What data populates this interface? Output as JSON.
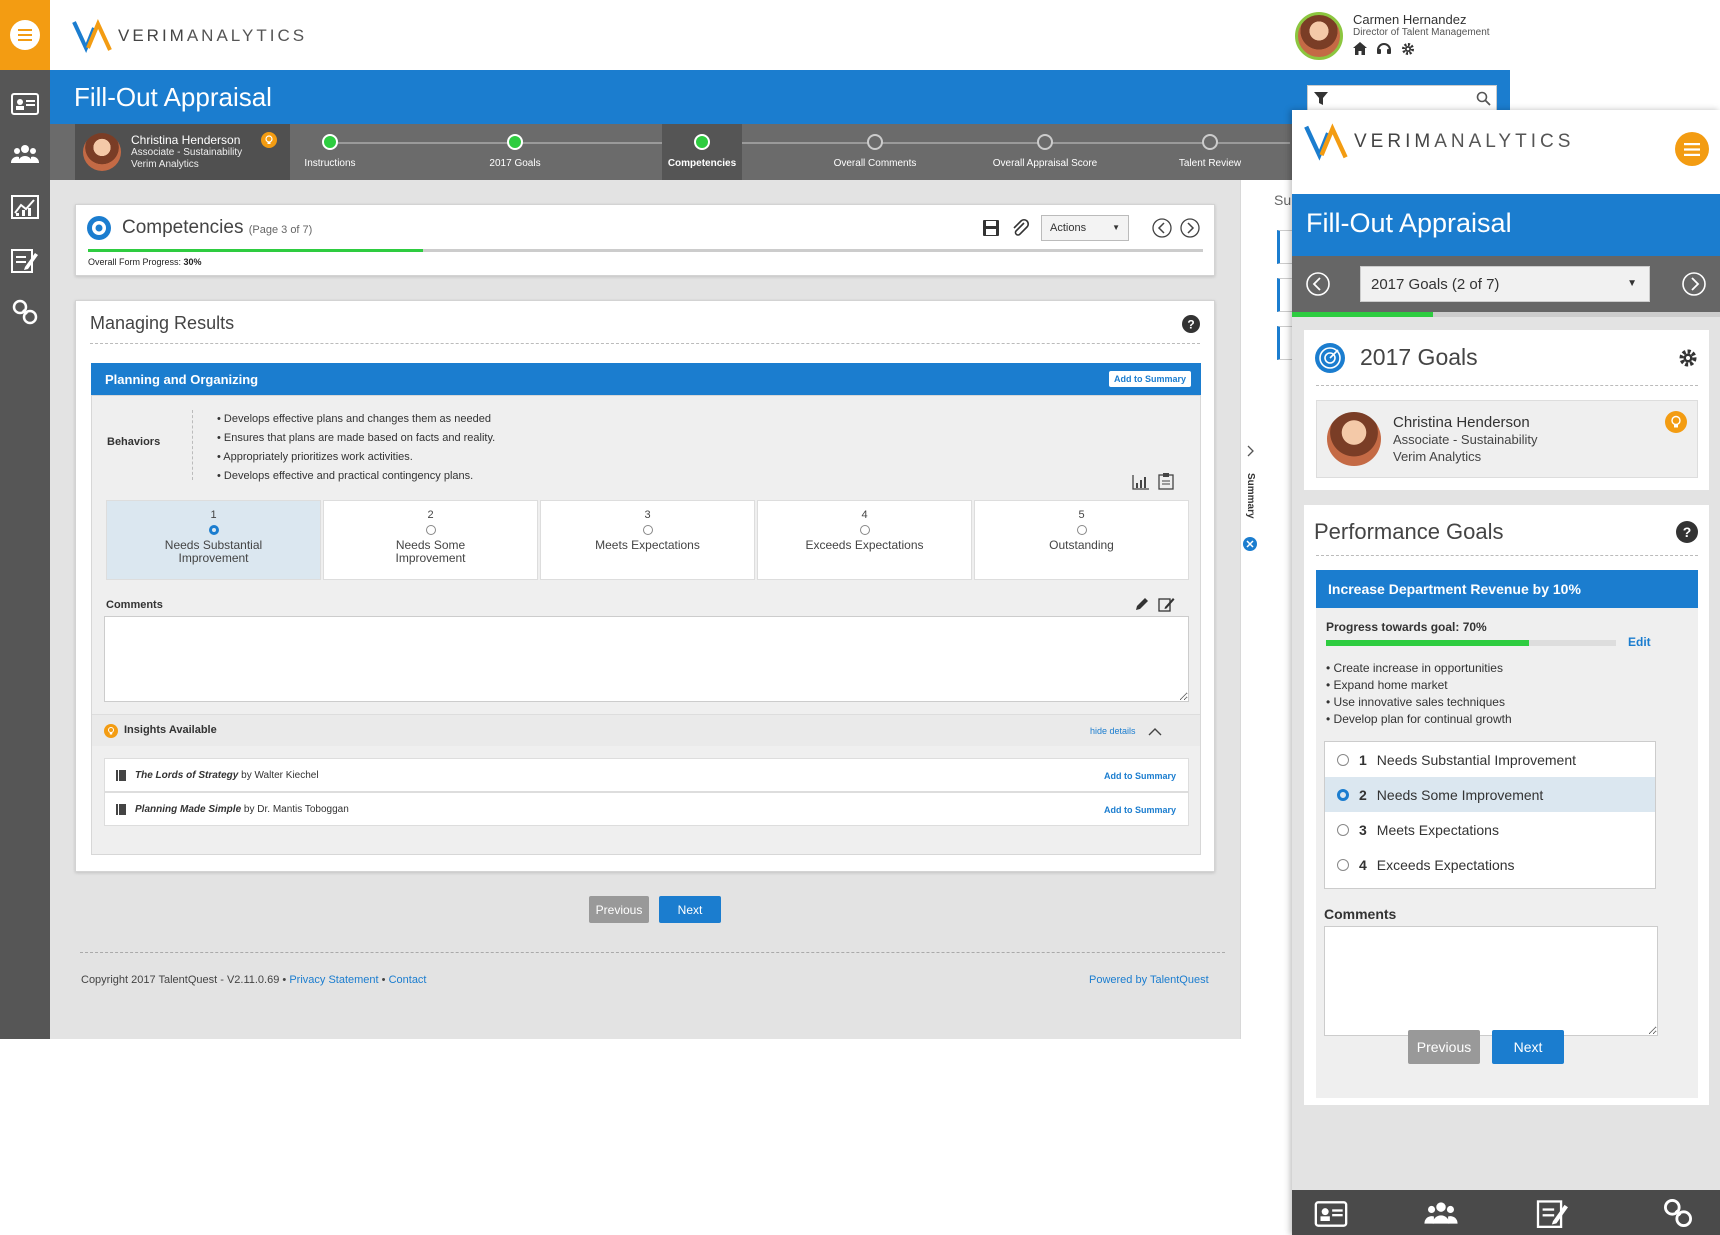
{
  "brand": {
    "logo_bold": "VERIM",
    "logo_rest": "ANALYTICS",
    "orange": "#f39c12",
    "blue": "#1b7dcf",
    "green": "#2ecc40"
  },
  "user": {
    "name": "Carmen Hernandez",
    "title": "Director of Talent Management"
  },
  "page": {
    "title": "Fill-Out Appraisal"
  },
  "employee": {
    "name": "Christina Henderson",
    "role": "Associate - Sustainability",
    "company": "Verim Analytics"
  },
  "steps": [
    {
      "label": "Instructions",
      "state": "done"
    },
    {
      "label": "2017 Goals",
      "state": "done"
    },
    {
      "label": "Competencies",
      "state": "current"
    },
    {
      "label": "Overall Comments",
      "state": "todo"
    },
    {
      "label": "Overall Appraisal Score",
      "state": "todo"
    },
    {
      "label": "Talent Review",
      "state": "todo"
    }
  ],
  "section": {
    "title": "Competencies",
    "page_info": "(Page 3 of 7)",
    "progress_label": "Overall Form Progress:",
    "progress_value": "30%",
    "progress_fraction": 0.3,
    "actions_label": "Actions"
  },
  "competency": {
    "group_title": "Managing Results",
    "item_title": "Planning and Organizing",
    "add_to_summary": "Add to Summary",
    "behaviors_label": "Behaviors",
    "behaviors": [
      "• Develops effective plans and changes them as needed",
      "• Ensures that plans are made based on facts and reality.",
      "• Appropriately prioritizes work activities.",
      "• Develops effective and practical contingency plans."
    ],
    "ratings": [
      {
        "num": "1",
        "label": "Needs Substantial Improvement",
        "selected": true
      },
      {
        "num": "2",
        "label": "Needs Some Improvement",
        "selected": false
      },
      {
        "num": "3",
        "label": "Meets Expectations",
        "selected": false
      },
      {
        "num": "4",
        "label": "Exceeds Expectations",
        "selected": false
      },
      {
        "num": "5",
        "label": "Outstanding",
        "selected": false
      }
    ],
    "comments_label": "Comments",
    "insights_label": "Insights Available",
    "hide_details": "hide details",
    "books": [
      {
        "title": "The Lords of Strategy",
        "by": " by Walter Kiechel",
        "action": "Add to Summary"
      },
      {
        "title": "Planning Made Simple",
        "by": " by Dr. Mantis Toboggan",
        "action": "Add to Summary"
      }
    ]
  },
  "buttons": {
    "previous": "Previous",
    "next": "Next"
  },
  "footer": {
    "copyright": "Copyright 2017 TalentQuest - V2.11.0.69",
    "privacy": "Privacy Statement",
    "contact": "Contact",
    "powered": "Powered by TalentQuest",
    "sep": "•"
  },
  "sidepanel": {
    "summary_label": "Summary",
    "summary_short": "Su"
  },
  "mobile": {
    "title": "Fill-Out Appraisal",
    "select_value": "2017 Goals (2 of 7)",
    "progress_fraction": 0.33,
    "goals_title": "2017 Goals",
    "perf_title": "Performance Goals",
    "goal_title": "Increase Department Revenue by 10%",
    "goal_progress_label": "Progress towards goal: 70%",
    "goal_progress_fraction": 0.7,
    "edit_label": "Edit",
    "goal_bullets": [
      "• Create increase in opportunities",
      "• Expand home market",
      "• Use innovative sales techniques",
      "• Develop plan for continual growth"
    ],
    "options": [
      {
        "num": "1",
        "label": "Needs Substantial Improvement",
        "selected": false
      },
      {
        "num": "2",
        "label": "Needs Some Improvement",
        "selected": true
      },
      {
        "num": "3",
        "label": "Meets Expectations",
        "selected": false
      },
      {
        "num": "4",
        "label": "Exceeds Expectations",
        "selected": false
      }
    ],
    "comments_label": "Comments",
    "previous": "Previous",
    "next": "Next"
  },
  "icons": [
    "menu-icon",
    "profile-card-icon",
    "people-icon",
    "chart-icon",
    "edit-form-icon",
    "links-icon",
    "home-icon",
    "headset-icon",
    "gear-icon",
    "filter-icon",
    "search-icon",
    "save-icon",
    "paperclip-icon",
    "chevron-left-icon",
    "chevron-right-icon",
    "help-icon",
    "bar-chart-icon",
    "notes-icon",
    "pencil-icon",
    "edit-icon",
    "lightbulb-icon",
    "book-icon",
    "chevron-up-icon",
    "target-icon"
  ]
}
